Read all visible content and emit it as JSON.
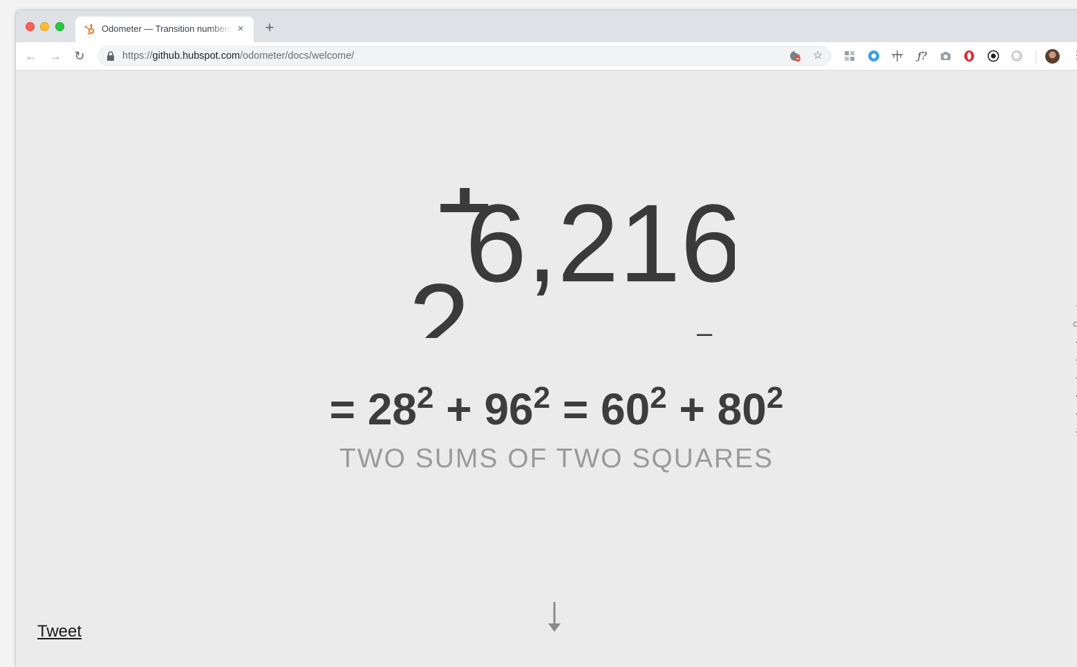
{
  "browser": {
    "tab": {
      "title": "Odometer — Transition numbers with ease",
      "favicon": "hubspot-sprocket-icon",
      "close_glyph": "×"
    },
    "new_tab_glyph": "+",
    "nav": {
      "back_glyph": "←",
      "forward_glyph": "→",
      "reload_glyph": "↻"
    },
    "url": {
      "scheme": "https://",
      "host": "github.hubspot.com",
      "path": "/odometer/docs/welcome/"
    },
    "extensions": [
      "cookie-blocker-icon",
      "bookmark-star-icon",
      "grid-extension-icon",
      "blue-circle-extension-icon",
      "crosshair-icon",
      "font-identifier-icon",
      "camera-icon",
      "opera-icon",
      "record-icon",
      "toggle-icon"
    ],
    "ext_glyphs": [
      "ƒ?",
      "☆"
    ]
  },
  "page": {
    "odometer": {
      "rolling_from": "2",
      "rolling_to": "1",
      "digits": "6,216",
      "partial_glyph": "‒"
    },
    "equation": {
      "eq1": "=",
      "b1": "28",
      "e1": "2",
      "plus1": "+",
      "b2": "96",
      "e2": "2",
      "eq2": "=",
      "b3": "60",
      "e3": "2",
      "plus2": "+",
      "b4": "80",
      "e4": "2"
    },
    "subtitle": "TWO SUMS OF TWO SQUARES",
    "tweet_label": "Tweet",
    "scroll_icon": "down-arrow-icon"
  },
  "colors": {
    "page_bg": "#ebebeb",
    "digit": "#3a3a3a",
    "subtitle": "#9a9a9a",
    "tab_strip": "#dee1e6"
  }
}
